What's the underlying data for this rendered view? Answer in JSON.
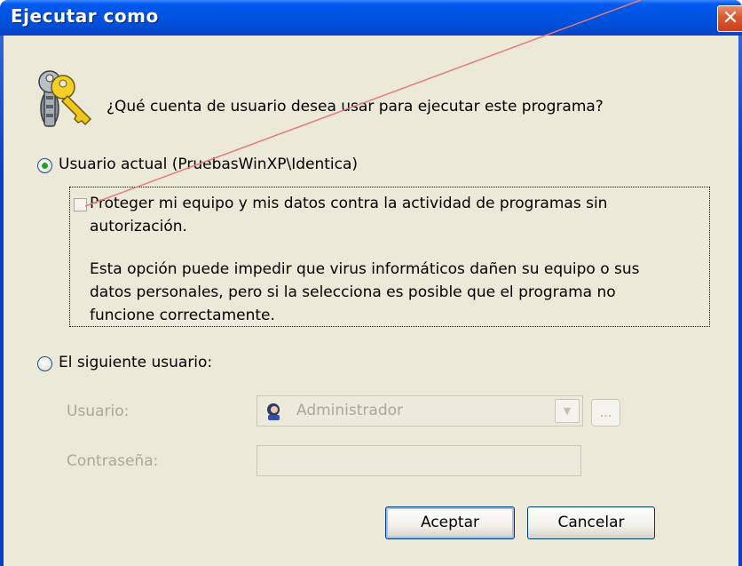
{
  "window": {
    "title": "Ejecutar como",
    "close_label": "✕"
  },
  "dialog": {
    "question": "¿Qué cuenta de usuario desea usar para ejecutar este programa?",
    "current_user": {
      "label": "Usuario actual (PruebasWinXP\\Identica)",
      "selected": true
    },
    "protect": {
      "line1": "Proteger mi equipo y mis datos contra la actividad de programas sin",
      "line2": "autorización.",
      "checked": false
    },
    "info": {
      "line1": "Esta opción puede impedir que virus informáticos dañen su equipo o sus",
      "line2": "datos personales,  pero si la selecciona es posible que el programa no",
      "line3": "funcione correctamente."
    },
    "other_user": {
      "label": "El siguiente usuario:",
      "selected": false
    },
    "user_label": "Usuario:",
    "user_value": "Administrador",
    "password_label": "Contraseña:",
    "password_value": "",
    "browse_label": "...",
    "ok_button": "Aceptar",
    "cancel_button": "Cancelar"
  },
  "colors": {
    "titlebar": "#0054e3",
    "client_bg": "#ece9d8",
    "close_button": "#dd5a2f",
    "radio_dot": "#21a121",
    "disabled_text": "#aca899",
    "annotation_line": "#e07c7c"
  },
  "icons": {
    "dialog_icon": "keys-icon",
    "user_icon": "user-icon",
    "combo_arrow": "chevron-down-icon"
  }
}
